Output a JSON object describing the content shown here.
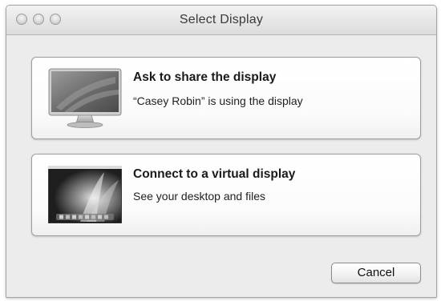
{
  "window": {
    "title": "Select Display"
  },
  "options": [
    {
      "heading": "Ask to share the display",
      "description": "“Casey Robin” is using the display",
      "icon": "monitor-icon"
    },
    {
      "heading": "Connect to a virtual display",
      "description": "See your desktop and files",
      "icon": "desktop-wallpaper-icon"
    }
  ],
  "buttons": {
    "cancel_label": "Cancel"
  },
  "colors": {
    "window_bg": "#ececec",
    "card_bg": "#ffffff",
    "border": "#9e9e9e"
  }
}
